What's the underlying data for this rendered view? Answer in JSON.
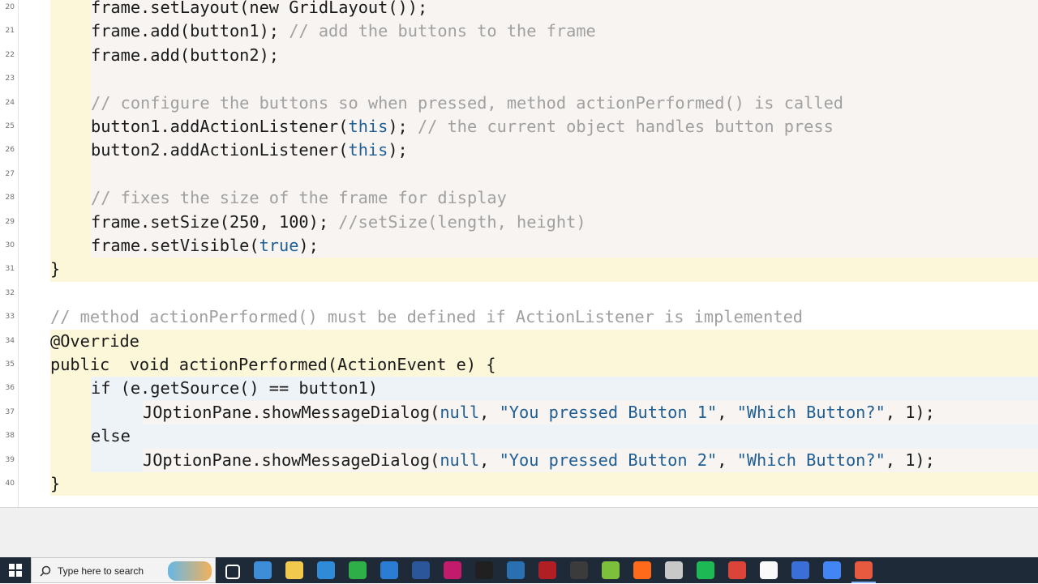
{
  "editor": {
    "line_numbers": [
      "20",
      "21",
      "22",
      "23",
      "24",
      "25",
      "26",
      "27",
      "28",
      "29",
      "30",
      "31",
      "32",
      "33",
      "34",
      "35",
      "36",
      "37",
      "38",
      "39",
      "40"
    ],
    "lines": [
      [
        {
          "t": "frame.setLayout(",
          "c": "p"
        },
        {
          "t": "new",
          "c": "kw"
        },
        {
          "t": " GridLayout());",
          "c": "p"
        }
      ],
      [
        {
          "t": "frame.add(button1); ",
          "c": "p"
        },
        {
          "t": "// add the buttons to the frame",
          "c": "cm"
        }
      ],
      [
        {
          "t": "frame.add(button2);",
          "c": "p"
        }
      ],
      [],
      [
        {
          "t": "// configure the buttons so when pressed, method actionPerformed() is called",
          "c": "cm"
        }
      ],
      [
        {
          "t": "button1.addActionListener(",
          "c": "p"
        },
        {
          "t": "this",
          "c": "lit"
        },
        {
          "t": "); ",
          "c": "p"
        },
        {
          "t": "// the current object handles button press",
          "c": "cm"
        }
      ],
      [
        {
          "t": "button2.addActionListener(",
          "c": "p"
        },
        {
          "t": "this",
          "c": "lit"
        },
        {
          "t": ");",
          "c": "p"
        }
      ],
      [],
      [
        {
          "t": "// fixes the size of the frame for display",
          "c": "cm"
        }
      ],
      [
        {
          "t": "frame.setSize(250, 100); ",
          "c": "p"
        },
        {
          "t": "//setSize(length, height)",
          "c": "cm"
        }
      ],
      [
        {
          "t": "frame.setVisible(",
          "c": "p"
        },
        {
          "t": "true",
          "c": "lit"
        },
        {
          "t": ");",
          "c": "p"
        }
      ],
      [
        {
          "t": "}",
          "c": "p"
        }
      ],
      [],
      [
        {
          "t": "// method actionPerformed() must be defined if ActionListener is implemented",
          "c": "cm"
        }
      ],
      [
        {
          "t": "@Override",
          "c": "p"
        }
      ],
      [
        {
          "t": "public",
          "c": "kw"
        },
        {
          "t": "  ",
          "c": "p"
        },
        {
          "t": "void",
          "c": "kw"
        },
        {
          "t": " actionPerformed(ActionEvent e) {",
          "c": "p"
        }
      ],
      [
        {
          "t": "if",
          "c": "kw"
        },
        {
          "t": " (e.getSource() == button1)",
          "c": "p"
        }
      ],
      [
        {
          "t": "JOptionPane.showMessageDialog(",
          "c": "p"
        },
        {
          "t": "null",
          "c": "lit"
        },
        {
          "t": ", ",
          "c": "p"
        },
        {
          "t": "\"You pressed Button 1\"",
          "c": "str"
        },
        {
          "t": ", ",
          "c": "p"
        },
        {
          "t": "\"Which Button?\"",
          "c": "str"
        },
        {
          "t": ", 1);",
          "c": "p"
        }
      ],
      [
        {
          "t": "else",
          "c": "kw"
        }
      ],
      [
        {
          "t": "JOptionPane.showMessageDialog(",
          "c": "p"
        },
        {
          "t": "null",
          "c": "lit"
        },
        {
          "t": ", ",
          "c": "p"
        },
        {
          "t": "\"You pressed Button 2\"",
          "c": "str"
        },
        {
          "t": ", ",
          "c": "p"
        },
        {
          "t": "\"Which Button?\"",
          "c": "str"
        },
        {
          "t": ", 1);",
          "c": "p"
        }
      ],
      [
        {
          "t": "}",
          "c": "p"
        }
      ]
    ]
  },
  "colors": {
    "method_bg": "#fbf7d8",
    "nested_bg": "#f7f4f2",
    "if_bg": "#eef3f8"
  },
  "taskbar": {
    "search_placeholder": "Type here to search",
    "icons": [
      "start-icon",
      "search-icon",
      "taskview-icon",
      "network-icon",
      "folder-icon",
      "calculator-icon",
      "code-editor-icon",
      "vscode-icon",
      "word-icon",
      "intellij-icon",
      "terminal-icon",
      "remote-icon",
      "filezilla-icon",
      "inkscape-icon",
      "gimp-icon",
      "firefox-icon",
      "disk-icon",
      "spotify-icon",
      "chrome-icon",
      "zoom-icon",
      "music-icon",
      "chrome-alt-icon",
      "coderunner-icon"
    ]
  }
}
